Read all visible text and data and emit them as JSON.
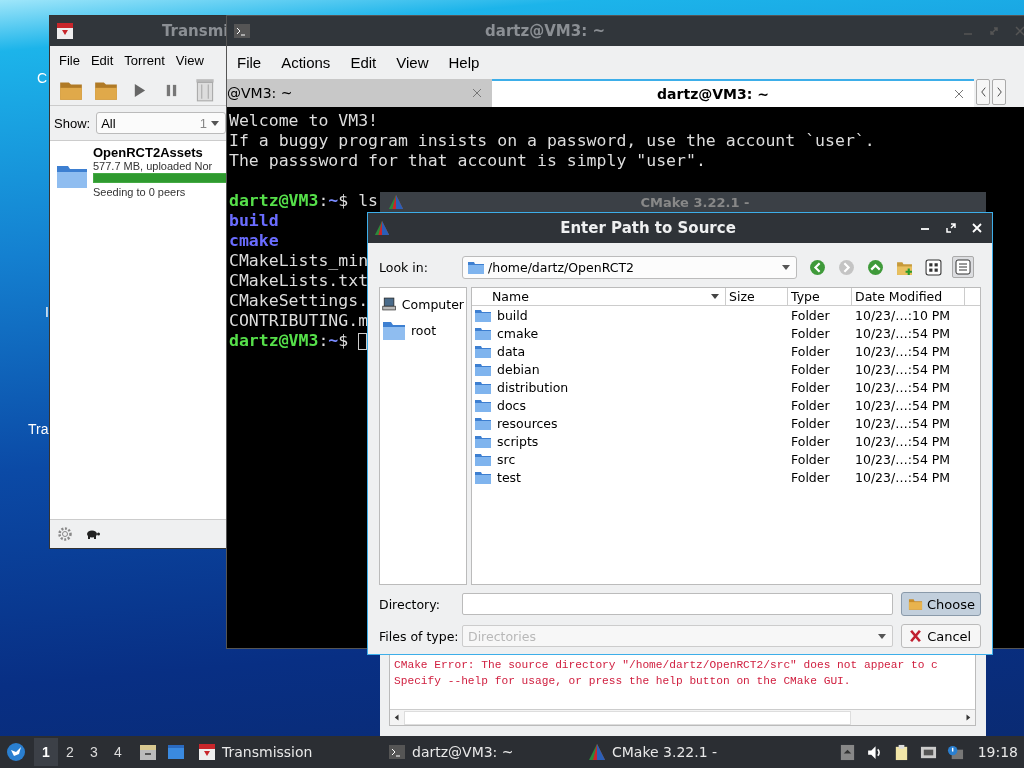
{
  "desktop": {
    "icon_labels": [
      "C",
      "I",
      "Tra"
    ]
  },
  "transmission": {
    "title": "Transmi",
    "menu": [
      "File",
      "Edit",
      "Torrent",
      "View"
    ],
    "show_label": "Show:",
    "filter": "All",
    "filter_count": "1",
    "torrents": [
      {
        "name": "OpenRCT2Assets",
        "info": "577.7 MB, uploaded Nor",
        "level": 1.0,
        "status": "Seeding to 0 peers"
      }
    ]
  },
  "terminal": {
    "title": "dartz@VM3: ~",
    "menu": [
      "File",
      "Actions",
      "Edit",
      "View",
      "Help"
    ],
    "tabs": [
      {
        "label": "@VM3: ~",
        "selected": false
      },
      {
        "label": "dartz@VM3: ~",
        "selected": true
      }
    ],
    "lines": [
      {
        "kind": "text",
        "text": "Welcome to VM3!"
      },
      {
        "kind": "text",
        "text": "If a buggy program insists on a password, use the account `user`."
      },
      {
        "kind": "text",
        "text": "The passsword for that account is simply \"user\"."
      },
      {
        "kind": "blank"
      },
      {
        "kind": "prompt",
        "user": "dartz@VM3",
        "sep": ":",
        "path": "~",
        "symbol": "$",
        "command": "ls",
        "cursor": false
      },
      {
        "kind": "dir",
        "text": "build"
      },
      {
        "kind": "dir",
        "text": "cmake"
      },
      {
        "kind": "text",
        "text": "CMakeLists_min"
      },
      {
        "kind": "text",
        "text": "CMakeLists.txt"
      },
      {
        "kind": "text",
        "text": "CMakeSettings."
      },
      {
        "kind": "text",
        "text": "CONTRIBUTING.m"
      },
      {
        "kind": "prompt",
        "user": "dartz@VM3",
        "sep": ":",
        "path": "~",
        "symbol": "$",
        "cursor": true
      }
    ]
  },
  "cmake": {
    "title": "CMake 3.22.1 -",
    "output": [
      "CMake Error: The source directory \"/home/dartz/OpenRCT2/src\" does not appear to c",
      "Specify --help for usage, or press the help button on the CMake GUI."
    ]
  },
  "dialog": {
    "title": "Enter Path to Source",
    "look_in_label": "Look in:",
    "look_in": "/home/dartz/OpenRCT2",
    "places": [
      {
        "label": "Computer",
        "kind": "computer"
      },
      {
        "label": "root",
        "kind": "folder"
      }
    ],
    "columns": [
      "Name",
      "Size",
      "Type",
      "Date Modified"
    ],
    "files": [
      {
        "name": "build",
        "type": "Folder",
        "modified": "10/23/…:10 PM"
      },
      {
        "name": "cmake",
        "type": "Folder",
        "modified": "10/23/…:54 PM"
      },
      {
        "name": "data",
        "type": "Folder",
        "modified": "10/23/…:54 PM"
      },
      {
        "name": "debian",
        "type": "Folder",
        "modified": "10/23/…:54 PM"
      },
      {
        "name": "distribution",
        "type": "Folder",
        "modified": "10/23/…:54 PM"
      },
      {
        "name": "docs",
        "type": "Folder",
        "modified": "10/23/…:54 PM"
      },
      {
        "name": "resources",
        "type": "Folder",
        "modified": "10/23/…:54 PM"
      },
      {
        "name": "scripts",
        "type": "Folder",
        "modified": "10/23/…:54 PM"
      },
      {
        "name": "src",
        "type": "Folder",
        "modified": "10/23/…:54 PM"
      },
      {
        "name": "test",
        "type": "Folder",
        "modified": "10/23/…:54 PM"
      }
    ],
    "directory_label": "Directory:",
    "type_label": "Files of type:",
    "type_value": "Directories",
    "type_disabled": true,
    "buttons": [
      {
        "label": "Choose",
        "kind": "choose",
        "default": true
      },
      {
        "label": "Cancel",
        "kind": "cancel",
        "default": false
      }
    ]
  },
  "taskbar": {
    "workspaces": [
      {
        "label": "1",
        "selected": true
      },
      {
        "label": "2",
        "selected": false
      },
      {
        "label": "3",
        "selected": false
      },
      {
        "label": "4",
        "selected": false
      }
    ],
    "tasks": [
      {
        "label": "Transmission",
        "kind": "transmission"
      },
      {
        "label": "dartz@VM3: ~",
        "kind": "terminal"
      },
      {
        "label": "CMake 3.22.1 -",
        "kind": "cmake"
      }
    ],
    "clock": "19:18"
  }
}
